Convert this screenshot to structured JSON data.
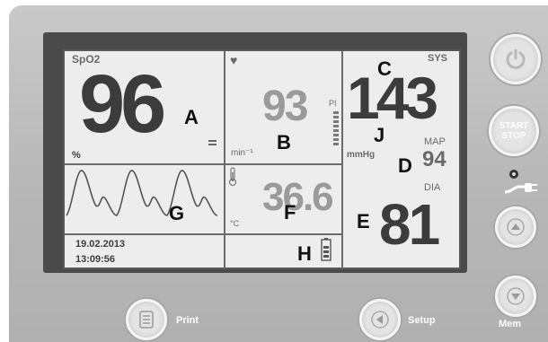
{
  "spo2": {
    "label": "SpO2",
    "value": "96",
    "unit": "%",
    "marker": "A"
  },
  "pulse": {
    "icon": "heart-icon",
    "value": "93",
    "unit": "min⁻¹",
    "pi_label": "PI",
    "marker": "B"
  },
  "blood_pressure": {
    "sys_label": "SYS",
    "sys_value": "143",
    "sys_marker": "C",
    "unit": "mmHg",
    "unit_marker": "J",
    "map_label": "MAP",
    "map_value": "94",
    "map_marker": "D",
    "dia_label": "DIA",
    "dia_value": "81",
    "dia_marker": "E"
  },
  "temperature": {
    "icon": "thermometer-icon",
    "value": "36.6",
    "unit": "°C",
    "marker": "F"
  },
  "waveform": {
    "marker": "G"
  },
  "status": {
    "date": "19.02.2013",
    "time": "13:09:56",
    "battery_icon": "battery-icon",
    "battery_marker": "H"
  },
  "buttons": {
    "power_icon": "power-icon",
    "start_stop": "START STOP",
    "start_stop_line1": "START",
    "start_stop_line2": "STOP",
    "up_icon": "up-arrow-icon",
    "down_icon": "down-arrow-icon",
    "mem_label": "Mem",
    "print_label": "Print",
    "print_icon": "printer-icon",
    "setup_label": "Setup",
    "setup_icon": "left-arrow-icon",
    "plug_icon": "plug-icon"
  }
}
